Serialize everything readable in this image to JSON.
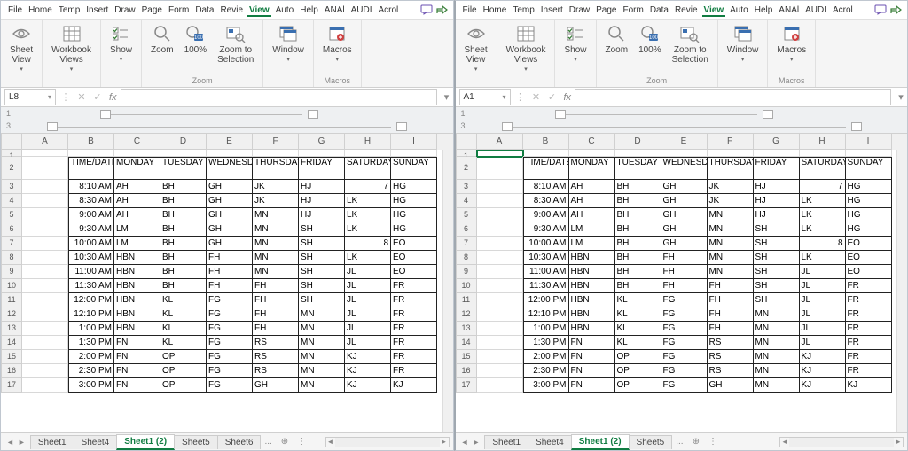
{
  "menu": [
    "File",
    "Home",
    "Temp",
    "Insert",
    "Draw",
    "Page",
    "Form",
    "Data",
    "Revie",
    "View",
    "Auto",
    "Help",
    "ANAl",
    "AUDI",
    "Acrol"
  ],
  "active_menu": "View",
  "ribbon": {
    "sheet_view": "Sheet\nView",
    "workbook_views": "Workbook\nViews",
    "show": "Show",
    "zoom": "Zoom",
    "pct": "100%",
    "zoom_sel": "Zoom to\nSelection",
    "window": "Window",
    "macros": "Macros",
    "group_zoom": "Zoom",
    "group_macros": "Macros"
  },
  "left": {
    "namebox": "L8",
    "sel": {
      "row": null,
      "col": null
    }
  },
  "right": {
    "namebox": "A1",
    "sel": {
      "row": 1,
      "col": 0
    }
  },
  "cols": [
    "A",
    "B",
    "C",
    "D",
    "E",
    "F",
    "G",
    "H",
    "I"
  ],
  "row_nums": [
    1,
    2,
    3,
    4,
    5,
    6,
    7,
    8,
    9,
    10,
    11,
    12,
    13,
    14,
    15,
    16,
    17
  ],
  "tabs": [
    "Sheet1",
    "Sheet4",
    "Sheet1 (2)",
    "Sheet5",
    "Sheet6"
  ],
  "tabs_r": [
    "Sheet1",
    "Sheet4",
    "Sheet1 (2)",
    "Sheet5"
  ],
  "tabs_more": "...",
  "active_tab": "Sheet1 (2)",
  "header_row": [
    "TIME/DATE",
    "MONDAY",
    "TUESDAY",
    "WEDNESDAY",
    "THURSDAY",
    "FRIDAY",
    "SATURDAY",
    "SUNDAY"
  ],
  "rows": [
    [
      "8:10 AM",
      "AH",
      "BH",
      "GH",
      "JK",
      "HJ",
      "7",
      "HG"
    ],
    [
      "8:30 AM",
      "AH",
      "BH",
      "GH",
      "JK",
      "HJ",
      "LK",
      "HG"
    ],
    [
      "9:00 AM",
      "AH",
      "BH",
      "GH",
      "MN",
      "HJ",
      "LK",
      "HG"
    ],
    [
      "9:30 AM",
      "LM",
      "BH",
      "GH",
      "MN",
      "SH",
      "LK",
      "HG"
    ],
    [
      "10:00 AM",
      "LM",
      "BH",
      "GH",
      "MN",
      "SH",
      "8",
      "EO"
    ],
    [
      "10:30 AM",
      "HBN",
      "BH",
      "FH",
      "MN",
      "SH",
      "LK",
      "EO"
    ],
    [
      "11:00 AM",
      "HBN",
      "BH",
      "FH",
      "MN",
      "SH",
      "JL",
      "EO"
    ],
    [
      "11:30 AM",
      "HBN",
      "BH",
      "FH",
      "FH",
      "SH",
      "JL",
      "FR"
    ],
    [
      "12:00 PM",
      "HBN",
      "KL",
      "FG",
      "FH",
      "SH",
      "JL",
      "FR"
    ],
    [
      "12:10 PM",
      "HBN",
      "KL",
      "FG",
      "FH",
      "MN",
      "JL",
      "FR"
    ],
    [
      "1:00 PM",
      "HBN",
      "KL",
      "FG",
      "FH",
      "MN",
      "JL",
      "FR"
    ],
    [
      "1:30 PM",
      "FN",
      "KL",
      "FG",
      "RS",
      "MN",
      "JL",
      "FR"
    ],
    [
      "2:00 PM",
      "FN",
      "OP",
      "FG",
      "RS",
      "MN",
      "KJ",
      "FR"
    ],
    [
      "2:30 PM",
      "FN",
      "OP",
      "FG",
      "RS",
      "MN",
      "KJ",
      "FR"
    ],
    [
      "3:00 PM",
      "FN",
      "OP",
      "FG",
      "GH",
      "MN",
      "KJ",
      "KJ"
    ]
  ]
}
